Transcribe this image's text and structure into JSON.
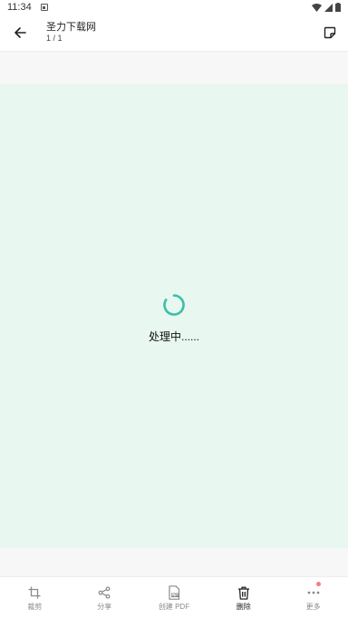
{
  "status_bar": {
    "time": "11:34"
  },
  "header": {
    "title": "圣力下载网",
    "page_indicator": "1 / 1"
  },
  "content": {
    "processing_text": "处理中......"
  },
  "toolbar": {
    "items": [
      {
        "label": "裁剪",
        "icon": "crop-icon"
      },
      {
        "label": "分享",
        "icon": "share-icon"
      },
      {
        "label": "创建 PDF",
        "icon": "pdf-icon"
      },
      {
        "label": "删除",
        "icon": "trash-icon"
      },
      {
        "label": "更多",
        "icon": "more-icon"
      }
    ]
  },
  "colors": {
    "accent": "#3cbfa8",
    "doc_background": "#e8f7ef",
    "badge": "#f08080"
  }
}
